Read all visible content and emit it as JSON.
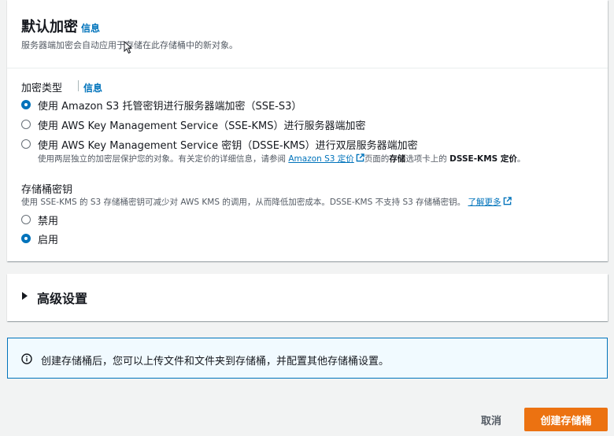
{
  "default_encryption": {
    "title": "默认加密",
    "info": "信息",
    "description": "服务器端加密会自动应用于存储在此存储桶中的新对象。"
  },
  "encryption_type": {
    "label": "加密类型",
    "info": "信息",
    "options": [
      {
        "label": "使用 Amazon S3 托管密钥进行服务器端加密（SSE-S3）",
        "checked": true
      },
      {
        "label": "使用 AWS Key Management Service（SSE-KMS）进行服务器端加密",
        "checked": false
      },
      {
        "label": "使用 AWS Key Management Service 密钥（DSSE-KMS）进行双层服务器端加密",
        "checked": false
      }
    ],
    "dsse_desc": {
      "prefix": "使用两层独立的加密层保护您的对象。有关定价的详细信息，请参阅",
      "link": "Amazon S3 定价",
      "mid1": "页面的",
      "bold1": "存储",
      "mid2": "选项卡上的",
      "bold2": "DSSE-KMS 定价",
      "suffix": "。"
    }
  },
  "bucket_key": {
    "label": "存储桶密钥",
    "description": "使用 SSE-KMS 的 S3 存储桶密钥可减少对 AWS KMS 的调用，从而降低加密成本。DSSE-KMS 不支持 S3 存储桶密钥。",
    "learn_more": "了解更多",
    "options": [
      {
        "label": "禁用",
        "checked": false
      },
      {
        "label": "启用",
        "checked": true
      }
    ]
  },
  "advanced": {
    "title": "高级设置"
  },
  "alert": {
    "text": "创建存储桶后，您可以上传文件和文件夹到存储桶，并配置其他存储桶设置。"
  },
  "footer": {
    "cancel": "取消",
    "create": "创建存储桶"
  },
  "colors": {
    "accent": "#0073bb",
    "primary_button": "#ec7211",
    "page_bg": "#f2f3f3"
  }
}
